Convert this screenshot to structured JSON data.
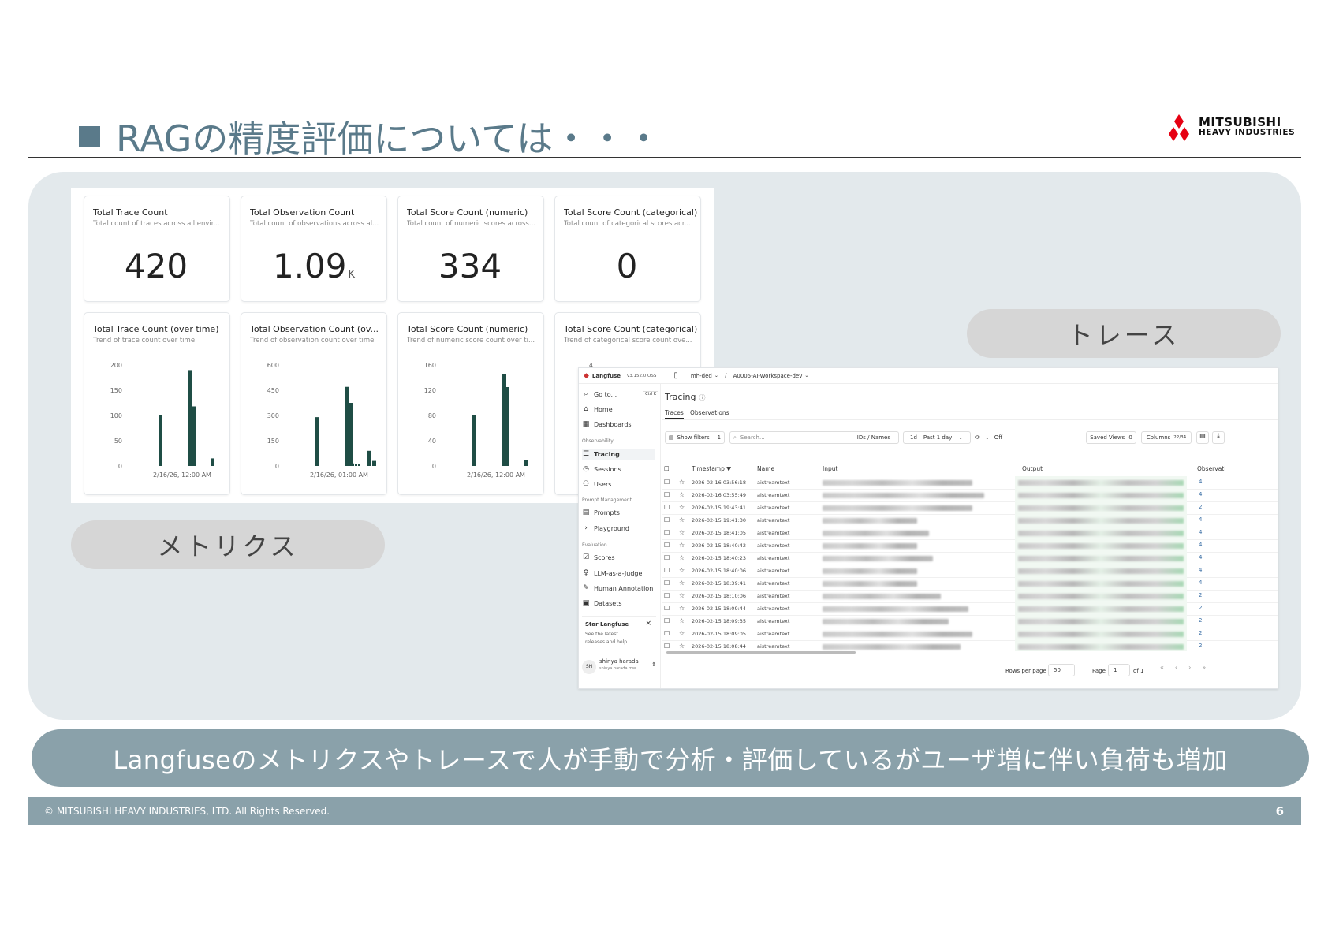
{
  "slide": {
    "title": "RAGの精度評価については・・・",
    "logo_line1": "MITSUBISHI",
    "logo_line2": "HEAVY INDUSTRIES",
    "pill_trace": "トレース",
    "pill_metrics": "メトリクス",
    "banner": "Langfuseのメトリクスやトレースで人が手動で分析・評価しているがユーザ増に伴い負荷も増加",
    "footer_copyright": "© MITSUBISHI HEAVY INDUSTRIES, LTD.  All Rights Reserved.",
    "page_number": "6"
  },
  "metrics": {
    "cards": [
      {
        "title": "Total Trace Count",
        "subtitle": "Total count of traces across all envir...",
        "value": "420",
        "unit": ""
      },
      {
        "title": "Total Observation Count",
        "subtitle": "Total count of observations across al...",
        "value": "1.09",
        "unit": "K"
      },
      {
        "title": "Total Score Count (numeric)",
        "subtitle": "Total count of numeric scores across...",
        "value": "334",
        "unit": ""
      },
      {
        "title": "Total Score Count (categorical)",
        "subtitle": "Total count of categorical scores acr...",
        "value": "0",
        "unit": ""
      }
    ],
    "charts": [
      {
        "title": "Total Trace Count (over time)",
        "subtitle": "Trend of trace count over time"
      },
      {
        "title": "Total Observation Count (ov...",
        "subtitle": "Trend of observation count over time"
      },
      {
        "title": "Total Score Count (numeric)",
        "subtitle": "Trend of numeric score count over ti..."
      },
      {
        "title": "Total Score Count (categorical)",
        "subtitle": "Trend of categorical score count ove..."
      }
    ]
  },
  "chart_data": [
    {
      "type": "bar",
      "xlabel": "2/16/26, 12:00 AM",
      "ylim": [
        0,
        200
      ],
      "yticks": [
        "200",
        "150",
        "100",
        "50",
        "0"
      ],
      "values": [
        100,
        190,
        118,
        15
      ],
      "color": "#1f4d45"
    },
    {
      "type": "bar",
      "xlabel": "2/16/26, 01:00 AM",
      "ylim": [
        0,
        600
      ],
      "yticks": [
        "600",
        "450",
        "300",
        "150",
        "0"
      ],
      "values": [
        290,
        470,
        375,
        15,
        10,
        10,
        90,
        30
      ],
      "color": "#1f4d45"
    },
    {
      "type": "bar",
      "xlabel": "2/16/26, 12:00 AM",
      "ylim": [
        0,
        160
      ],
      "yticks": [
        "160",
        "120",
        "80",
        "40",
        "0"
      ],
      "values": [
        80,
        145,
        125,
        10
      ],
      "color": "#1f4d45"
    },
    {
      "type": "bar",
      "xlabel": "",
      "ylim": [
        0,
        4
      ],
      "yticks": [
        "4"
      ],
      "values": [],
      "color": "#1f4d45"
    }
  ],
  "langfuse": {
    "brand": "Langfuse",
    "version": "v3.152.0 OSS",
    "org": "mh-ded",
    "project": "A0005-AI-Workspace-dev",
    "goto": "Go to...",
    "shortcut": "Ctrl K",
    "nav": [
      "Home",
      "Dashboards"
    ],
    "section_observability": "Observability",
    "nav_obs": [
      "Tracing",
      "Sessions",
      "Users"
    ],
    "section_prompt": "Prompt Management",
    "nav_prompt": [
      "Prompts",
      "Playground"
    ],
    "section_eval": "Evaluation",
    "nav_eval": [
      "Scores",
      "LLM-as-a-Judge",
      "Human Annotation",
      "Datasets"
    ],
    "star_title": "Star Langfuse",
    "star_text1": "See the latest",
    "star_text2": "releases and help",
    "user_initials": "SH",
    "user_name": "shinya harada",
    "user_email": "shinya.harada.mw...",
    "page_title": "Tracing",
    "tabs": [
      "Traces",
      "Observations"
    ],
    "show_filters": "Show filters",
    "filter_count": "1",
    "search_placeholder": "Search...",
    "ids_names": "IDs / Names",
    "range_short": "1d",
    "range": "Past 1 day",
    "refresh": "Off",
    "saved_views": "Saved Views",
    "saved_views_count": "0",
    "columns": "Columns",
    "columns_count": "22/34",
    "col_timestamp": "Timestamp",
    "col_name": "Name",
    "col_input": "Input",
    "col_output": "Output",
    "col_obs": "Observati",
    "rows": [
      {
        "ts": "2026-02-16 03:56:18",
        "name": "aistreamtext",
        "obs": "4"
      },
      {
        "ts": "2026-02-16 03:55:49",
        "name": "aistreamtext",
        "obs": "4"
      },
      {
        "ts": "2026-02-15 19:43:41",
        "name": "aistreamtext",
        "obs": "2"
      },
      {
        "ts": "2026-02-15 19:41:30",
        "name": "aistreamtext",
        "obs": "4"
      },
      {
        "ts": "2026-02-15 18:41:05",
        "name": "aistreamtext",
        "obs": "4"
      },
      {
        "ts": "2026-02-15 18:40:42",
        "name": "aistreamtext",
        "obs": "4"
      },
      {
        "ts": "2026-02-15 18:40:23",
        "name": "aistreamtext",
        "obs": "4"
      },
      {
        "ts": "2026-02-15 18:40:06",
        "name": "aistreamtext",
        "obs": "4"
      },
      {
        "ts": "2026-02-15 18:39:41",
        "name": "aistreamtext",
        "obs": "4"
      },
      {
        "ts": "2026-02-15 18:10:06",
        "name": "aistreamtext",
        "obs": "2"
      },
      {
        "ts": "2026-02-15 18:09:44",
        "name": "aistreamtext",
        "obs": "2"
      },
      {
        "ts": "2026-02-15 18:09:35",
        "name": "aistreamtext",
        "obs": "2"
      },
      {
        "ts": "2026-02-15 18:09:05",
        "name": "aistreamtext",
        "obs": "2"
      },
      {
        "ts": "2026-02-15 18:08:44",
        "name": "aistreamtext",
        "obs": "2"
      }
    ],
    "rows_per_page_label": "Rows per page",
    "rows_per_page": "50",
    "page_label": "Page",
    "page_value": "1",
    "of_label": "of 1"
  }
}
